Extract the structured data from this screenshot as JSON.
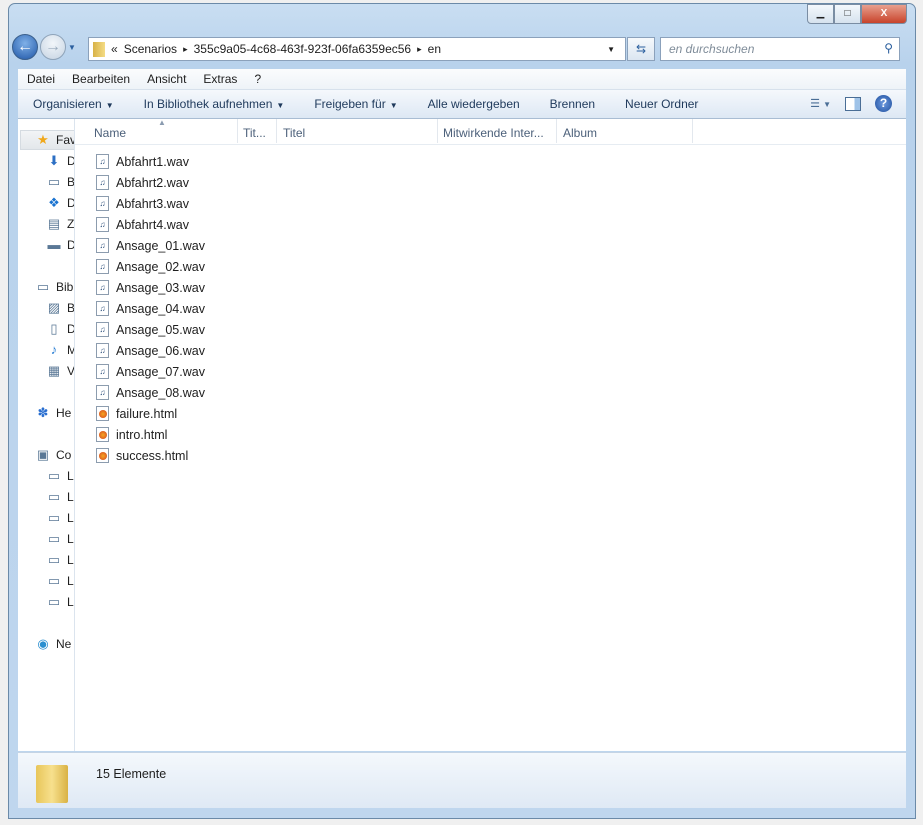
{
  "window": {
    "buttons": {
      "minimize": "▁",
      "maximize": "□",
      "close": "X"
    }
  },
  "address": {
    "overflow": "«",
    "crumbs": [
      "Scenarios",
      "355c9a05-4c68-463f-923f-06fa6359ec56",
      "en"
    ],
    "separator": "▸"
  },
  "search": {
    "placeholder": "en durchsuchen"
  },
  "menu": [
    "Datei",
    "Bearbeiten",
    "Ansicht",
    "Extras",
    "?"
  ],
  "commands": [
    {
      "label": "Organisieren",
      "dropdown": true
    },
    {
      "label": "In Bibliothek aufnehmen",
      "dropdown": true
    },
    {
      "label": "Freigeben für",
      "dropdown": true
    },
    {
      "label": "Alle wiedergeben",
      "dropdown": false
    },
    {
      "label": "Brennen",
      "dropdown": false
    },
    {
      "label": "Neuer Ordner",
      "dropdown": false
    }
  ],
  "nav": [
    {
      "label": "Fav",
      "icon": "star-icon"
    },
    {
      "label": "D",
      "icon": "downloads-icon"
    },
    {
      "label": "B",
      "icon": "folder-icon"
    },
    {
      "label": "D",
      "icon": "dropbox-icon"
    },
    {
      "label": "Z",
      "icon": "recent-places-icon"
    },
    {
      "label": "D",
      "icon": "desktop-icon"
    },
    {
      "label": "Bib",
      "icon": "libraries-icon"
    },
    {
      "label": "B",
      "icon": "pictures-icon"
    },
    {
      "label": "D",
      "icon": "documents-icon"
    },
    {
      "label": "M",
      "icon": "music-icon"
    },
    {
      "label": "V",
      "icon": "videos-icon"
    },
    {
      "label": "He",
      "icon": "homegroup-icon"
    },
    {
      "label": "Co",
      "icon": "computer-icon"
    },
    {
      "label": "L",
      "icon": "system-drive-icon"
    },
    {
      "label": "L",
      "icon": "drive-icon"
    },
    {
      "label": "L",
      "icon": "drive-icon"
    },
    {
      "label": "L",
      "icon": "drive-icon"
    },
    {
      "label": "L",
      "icon": "drive-icon"
    },
    {
      "label": "L",
      "icon": "drive-icon"
    },
    {
      "label": "L",
      "icon": "drive-icon"
    },
    {
      "label": "Ne",
      "icon": "network-icon"
    }
  ],
  "columns": [
    "Name",
    "Tit...",
    "Titel",
    "Mitwirkende Inter...",
    "Album"
  ],
  "files": [
    {
      "name": "Abfahrt1.wav",
      "type": "wav"
    },
    {
      "name": "Abfahrt2.wav",
      "type": "wav"
    },
    {
      "name": "Abfahrt3.wav",
      "type": "wav"
    },
    {
      "name": "Abfahrt4.wav",
      "type": "wav"
    },
    {
      "name": "Ansage_01.wav",
      "type": "wav"
    },
    {
      "name": "Ansage_02.wav",
      "type": "wav"
    },
    {
      "name": "Ansage_03.wav",
      "type": "wav"
    },
    {
      "name": "Ansage_04.wav",
      "type": "wav"
    },
    {
      "name": "Ansage_05.wav",
      "type": "wav"
    },
    {
      "name": "Ansage_06.wav",
      "type": "wav"
    },
    {
      "name": "Ansage_07.wav",
      "type": "wav"
    },
    {
      "name": "Ansage_08.wav",
      "type": "wav"
    },
    {
      "name": "failure.html",
      "type": "html"
    },
    {
      "name": "intro.html",
      "type": "html"
    },
    {
      "name": "success.html",
      "type": "html"
    }
  ],
  "status": {
    "count": "15 Elemente"
  }
}
